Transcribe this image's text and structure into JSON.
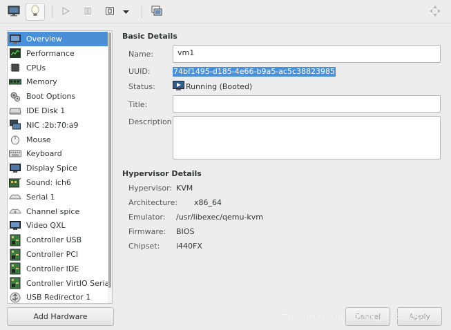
{
  "sidebar": {
    "items": [
      {
        "label": "Overview",
        "icon": "overview-monitor-icon"
      },
      {
        "label": "Performance",
        "icon": "performance-graph-icon"
      },
      {
        "label": "CPUs",
        "icon": "cpu-chip-icon"
      },
      {
        "label": "Memory",
        "icon": "memory-module-icon"
      },
      {
        "label": "Boot Options",
        "icon": "boot-gear-icon"
      },
      {
        "label": "IDE Disk 1",
        "icon": "disk-drive-icon"
      },
      {
        "label": "NIC :2b:70:a9",
        "icon": "network-card-icon"
      },
      {
        "label": "Mouse",
        "icon": "mouse-icon"
      },
      {
        "label": "Keyboard",
        "icon": "keyboard-icon"
      },
      {
        "label": "Display Spice",
        "icon": "display-monitor-icon"
      },
      {
        "label": "Sound: ich6",
        "icon": "sound-card-icon"
      },
      {
        "label": "Serial 1",
        "icon": "serial-port-icon"
      },
      {
        "label": "Channel spice",
        "icon": "channel-icon"
      },
      {
        "label": "Video QXL",
        "icon": "video-card-icon"
      },
      {
        "label": "Controller USB",
        "icon": "controller-board-icon"
      },
      {
        "label": "Controller PCI",
        "icon": "controller-board-icon"
      },
      {
        "label": "Controller IDE",
        "icon": "controller-board-icon"
      },
      {
        "label": "Controller VirtIO Serial",
        "icon": "controller-board-icon"
      },
      {
        "label": "USB Redirector 1",
        "icon": "usb-redirector-icon"
      }
    ],
    "add_hardware_label": "Add Hardware"
  },
  "basic": {
    "title": "Basic Details",
    "name_label": "Name:",
    "name_value": "vm1",
    "uuid_label": "UUID:",
    "uuid_value": "74bf1495-d185-4e66-b9a5-ac5c38823985",
    "status_label": "Status:",
    "status_value": "Running (Booted)",
    "title_label": "Title:",
    "title_value": "",
    "description_label": "Description:",
    "description_value": ""
  },
  "hypervisor": {
    "title": "Hypervisor Details",
    "rows": [
      {
        "label": "Hypervisor:",
        "value": "KVM"
      },
      {
        "label": "Architecture:",
        "value": "x86_64"
      },
      {
        "label": "Emulator:",
        "value": "/usr/libexec/qemu-kvm"
      },
      {
        "label": "Firmware:",
        "value": "BIOS"
      },
      {
        "label": "Chipset:",
        "value": "i440FX"
      }
    ]
  },
  "footer": {
    "cancel_label": "Cancel",
    "apply_label": "Apply"
  },
  "watermark": "https://blog.csdn.net/qq_41168390",
  "colors": {
    "selection": "#4a90d9",
    "window_bg": "#ededed"
  }
}
